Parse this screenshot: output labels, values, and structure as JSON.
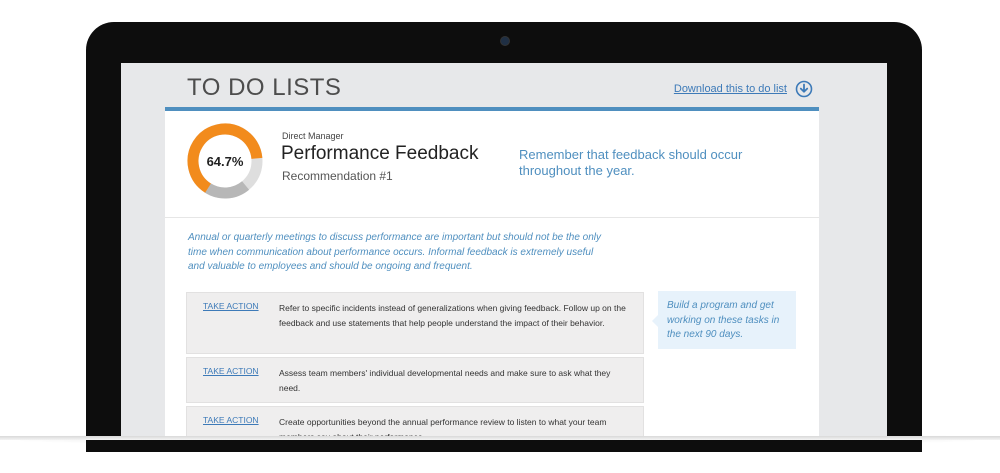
{
  "page": {
    "title": "TO DO LISTS",
    "download_label": "Download this to do list",
    "download_icon": "download-arrow-circle-icon"
  },
  "summary": {
    "percent_label": "64.7%",
    "percent_value": 0.647,
    "eyebrow": "Direct Manager",
    "title": "Performance Feedback",
    "recommendation": "Recommendation #1",
    "tip": "Remember that feedback should occur throughout the year."
  },
  "intro_text": "Annual or quarterly meetings to discuss performance are important but should not be the only time when communication about performance occurs. Informal feedback is extremely useful and valuable to employees and should be ongoing and frequent.",
  "actions": [
    {
      "link": "TAKE ACTION",
      "text": "Refer to specific incidents instead of generalizations when giving feedback. Follow up on the feedback and use statements that help people understand the impact of their behavior."
    },
    {
      "link": "TAKE ACTION",
      "text": "Assess team members' individual developmental needs and make sure to ask what they need."
    },
    {
      "link": "TAKE ACTION",
      "text": "Create opportunities beyond the annual performance review to listen to what your team members say about their performance."
    }
  ],
  "callout": "Build a program and get working on these tasks in the next 90 days.",
  "colors": {
    "accent_blue": "#4f8fbf",
    "donut_orange": "#f28b1c",
    "donut_gray": "#b7b7b7",
    "donut_light": "#dedede",
    "bezel": "#0d0d0d"
  }
}
